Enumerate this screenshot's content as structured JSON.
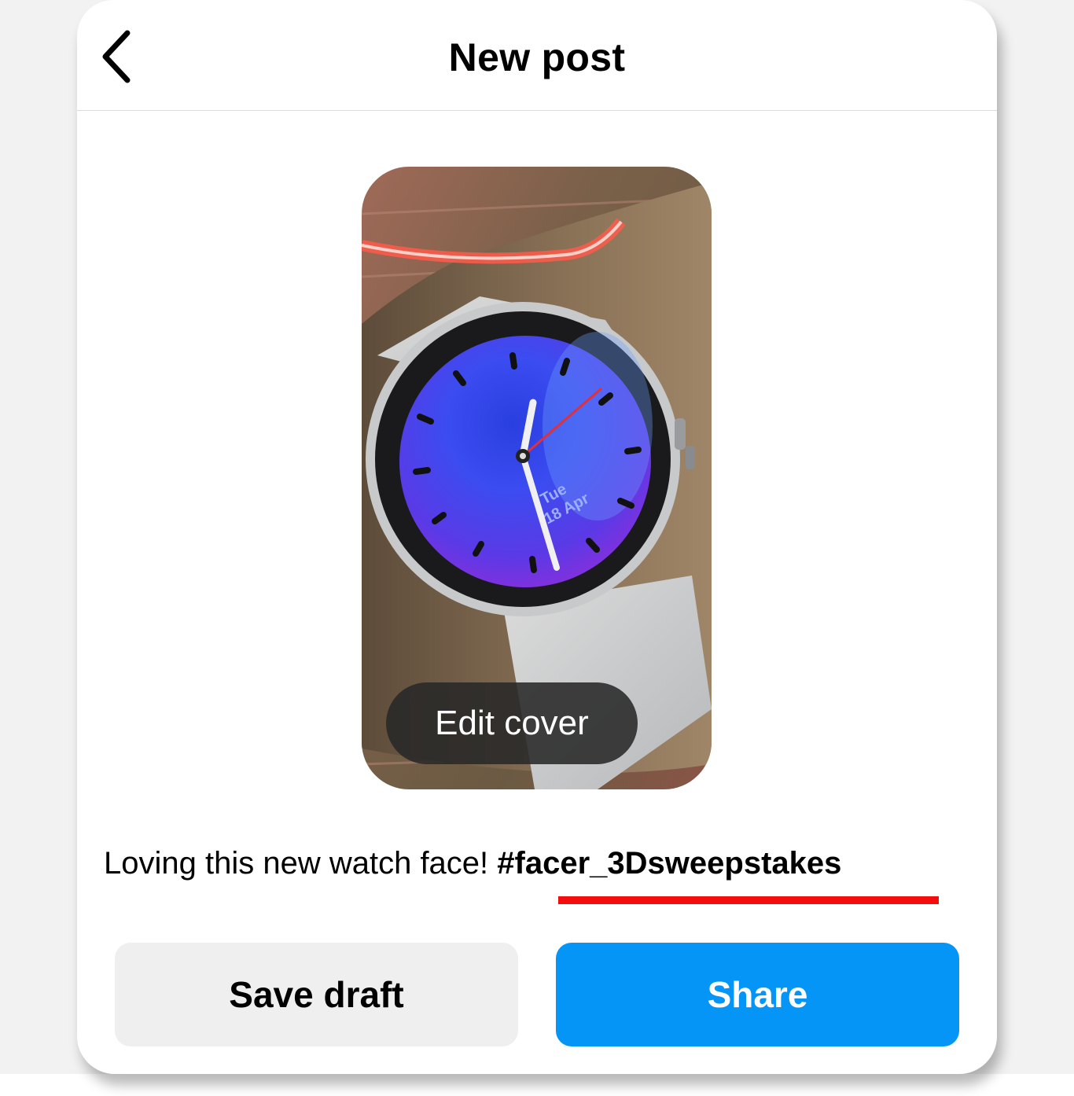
{
  "header": {
    "title": "New post",
    "back_icon": "chevron-left-icon"
  },
  "media": {
    "edit_cover_label": "Edit cover",
    "watch_date_line1": "Tue",
    "watch_date_line2": "18 Apr"
  },
  "caption": {
    "text": "Loving this new watch face! ",
    "hashtag": "#facer_3Dsweepstakes"
  },
  "actions": {
    "save_draft_label": "Save draft",
    "share_label": "Share"
  },
  "colors": {
    "share_button": "#0495f6",
    "save_draft_button": "#efefef",
    "hashtag_underline": "#f40d0d"
  }
}
